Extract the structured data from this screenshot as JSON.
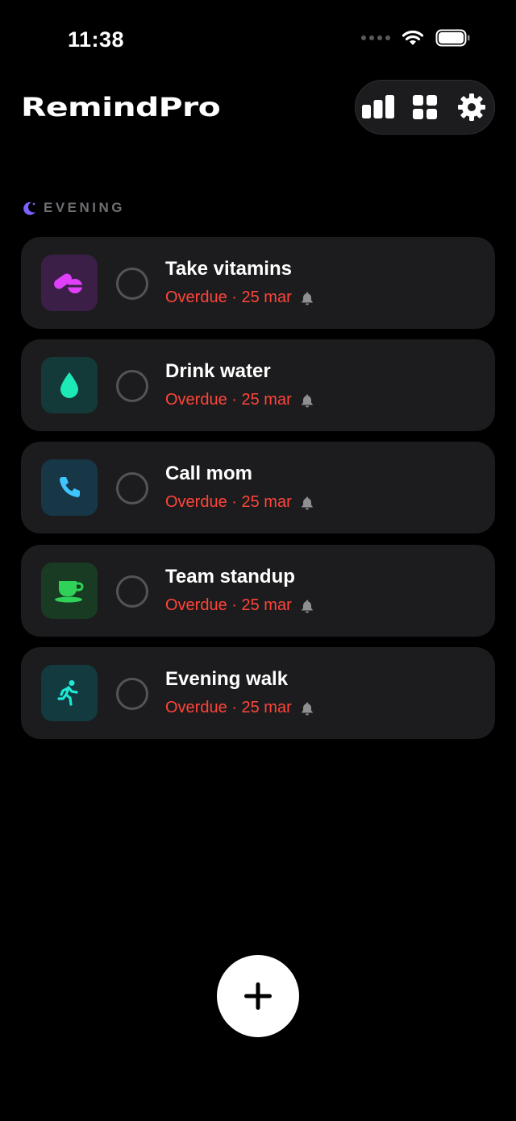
{
  "status_bar": {
    "time": "11:38"
  },
  "app": {
    "title": "RemindPro"
  },
  "toolbar": {
    "items": [
      {
        "icon": "bar-chart-icon"
      },
      {
        "icon": "grid-icon"
      },
      {
        "icon": "gear-icon"
      }
    ]
  },
  "section": {
    "label": "EVENING",
    "icon": "moon-icon",
    "icon_color": "#7b61ff"
  },
  "reminders": [
    {
      "title": "Take vitamins",
      "status": "Overdue · 25 mar",
      "icon": "pills-icon",
      "icon_color": "#e040fb",
      "tile_color": "#3c1f47"
    },
    {
      "title": "Drink water",
      "status": "Overdue · 25 mar",
      "icon": "water-drop-icon",
      "icon_color": "#1de9b6",
      "tile_color": "#133a38"
    },
    {
      "title": "Call mom",
      "status": "Overdue · 25 mar",
      "icon": "phone-icon",
      "icon_color": "#40c4ff",
      "tile_color": "#173747"
    },
    {
      "title": "Team standup",
      "status": "Overdue · 25 mar",
      "icon": "coffee-cup-icon",
      "icon_color": "#30d158",
      "tile_color": "#193a23"
    },
    {
      "title": "Evening walk",
      "status": "Overdue · 25 mar",
      "icon": "walking-icon",
      "icon_color": "#1de9d6",
      "tile_color": "#133a3e"
    }
  ],
  "colors": {
    "background": "#000000",
    "card": "#1c1c1e",
    "overdue": "#ff453a",
    "muted": "#6e6e73"
  }
}
